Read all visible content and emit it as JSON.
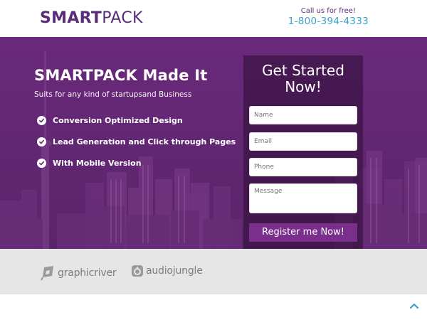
{
  "header": {
    "logo_bold": "SMART",
    "logo_light": "PACK",
    "call_label": "Call us for free!",
    "phone": "1-800-394-4333"
  },
  "hero": {
    "title": "SMARTPACK Made It",
    "subtitle": "Suits for any kind of startupsand Business",
    "features": [
      "Conversion Optimized Design",
      "Lead Generation and Click through Pages",
      "With Mobile Version"
    ]
  },
  "form": {
    "title": "Get Started Now!",
    "name_placeholder": "Name",
    "email_placeholder": "Email",
    "phone_placeholder": "Phone",
    "message_placeholder": "Message",
    "submit_label": "Register me Now!"
  },
  "partners": [
    {
      "name": "graphicriver",
      "icon": "graphicriver-logo-icon"
    },
    {
      "name": "audiojungle",
      "icon": "audiojungle-logo-icon"
    }
  ],
  "colors": {
    "brand": "#5a2b7d",
    "phone_accent": "#3aa3c9",
    "hero_overlay": "#6a2a78",
    "button": "#7a2f8c"
  },
  "icons": {
    "check": "check-circle-icon",
    "back_to_top": "chevron-up-icon"
  }
}
